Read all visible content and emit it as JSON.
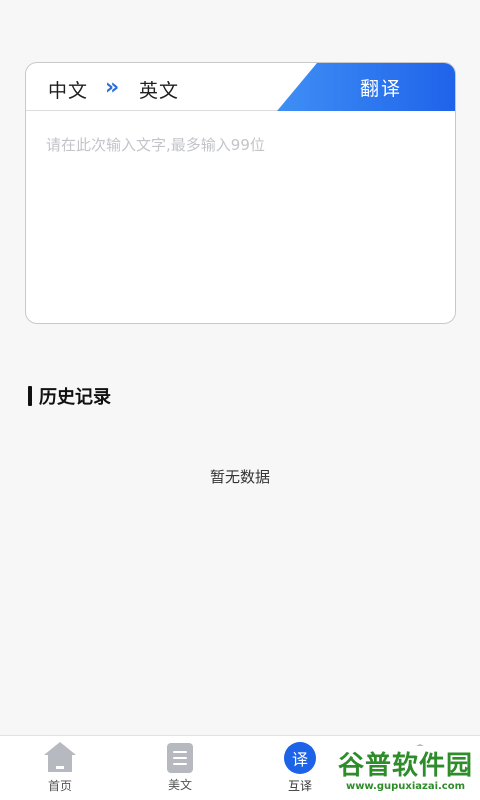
{
  "translator": {
    "source_lang": "中文",
    "swap_symbol": "»",
    "target_lang": "英文",
    "translate_button": "翻译",
    "input_placeholder": "请在此次输入文字,最多输入99位",
    "input_value": ""
  },
  "history": {
    "title": "历史记录",
    "empty_text": "暂无数据"
  },
  "tabbar": {
    "items": [
      {
        "label": "首页",
        "icon": "home-icon",
        "active": false
      },
      {
        "label": "美文",
        "icon": "article-icon",
        "active": false
      },
      {
        "label": "互译",
        "icon": "translate-icon",
        "icon_text": "译",
        "active": true
      },
      {
        "label": "",
        "icon": "mine-icon",
        "active": false
      }
    ]
  },
  "watermark": {
    "title": "谷普软件园",
    "url": "www.gupuxiazai.com"
  },
  "colors": {
    "accent": "#1d63e8",
    "icon_inactive": "#b6b9bf",
    "background": "#f7f7f8"
  }
}
